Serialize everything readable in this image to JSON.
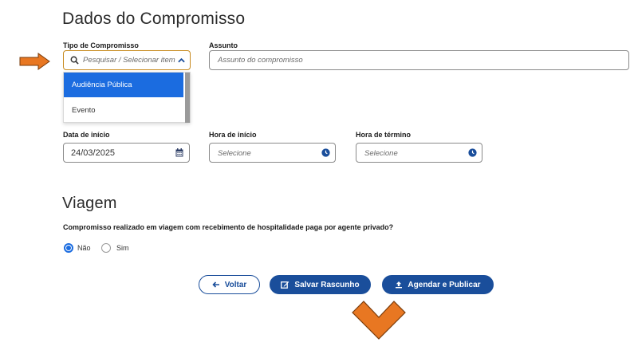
{
  "section_commitment": {
    "title": "Dados do Compromisso"
  },
  "fields": {
    "tipo": {
      "label": "Tipo de Compromisso",
      "placeholder": "Pesquisar / Selecionar item",
      "options": [
        "Audiência Pública",
        "Evento"
      ],
      "selected_index": 0
    },
    "assunto": {
      "label": "Assunto",
      "placeholder": "Assunto do compromisso"
    },
    "data_inicio": {
      "label": "Data de início",
      "value": "24/03/2025"
    },
    "hora_inicio": {
      "label": "Hora de início",
      "placeholder": "Selecione"
    },
    "hora_termino": {
      "label": "Hora de término",
      "placeholder": "Selecione"
    }
  },
  "section_travel": {
    "title": "Viagem",
    "question": "Compromisso realizado em viagem com recebimento de hospitalidade paga por agente privado?",
    "options": [
      "Não",
      "Sim"
    ],
    "selected": "Não"
  },
  "actions": {
    "back": "Voltar",
    "save_draft": "Salvar Rascunho",
    "schedule_publish": "Agendar e Publicar"
  },
  "colors": {
    "primary": "#1a4e9b",
    "selected": "#1b6ce0",
    "annotation_arrow": "#e87722",
    "focus_border": "#c78a1e"
  },
  "icons": [
    "search-icon",
    "chevron-up-icon",
    "calendar-icon",
    "clock-icon",
    "arrow-left-icon",
    "edit-icon",
    "upload-icon",
    "annotation-arrow-right",
    "annotation-arrow-down"
  ]
}
